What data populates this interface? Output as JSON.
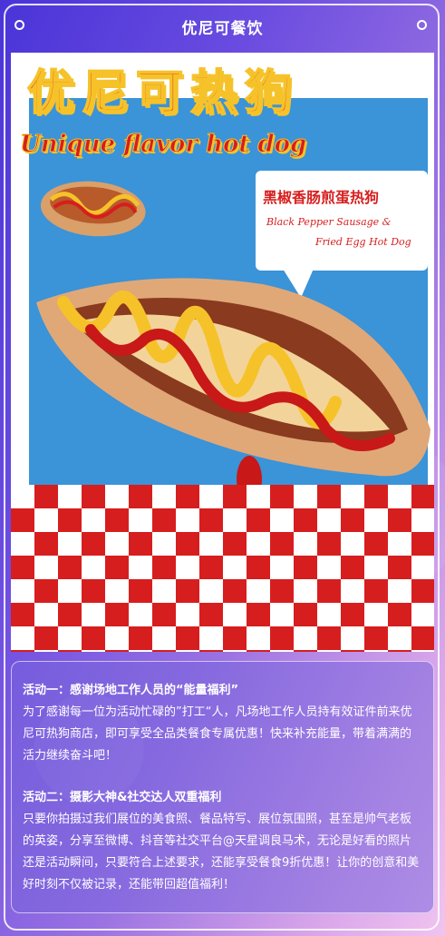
{
  "header": {
    "title": "优尼可餐饮"
  },
  "poster": {
    "title_cn": "优尼可热狗",
    "title_en": "Unique flavor hot dog",
    "bubble_cn": "黑椒香肠煎蛋热狗",
    "bubble_en_line1": "Black Pepper Sausage &",
    "bubble_en_line2": "Fried Egg Hot Dog"
  },
  "info": {
    "activity1_title": "活动一：感谢场地工作人员的“能量福利”",
    "activity1_body": "为了感谢每一位为活动忙碌的”打工“人，凡场地工作人员持有效证件前来优尼可热狗商店，即可享受全品类餐食专属优惠！快来补充能量，带着满满的活力继续奋斗吧！",
    "activity2_title": "活动二：摄影大神&社交达人双重福利",
    "activity2_body": "只要你拍摄过我们展位的美食照、餐品特写、展位氛围照，甚至是帅气老板的英姿，分享至微博、抖音等社交平台@天星调良马术，无论是好看的照片还是活动瞬间，只要符合上述要求，还能享受餐食9折优惠！让你的创意和美好时刻不仅被记录，还能带回超值福利！"
  },
  "colors": {
    "accent_red": "#d71e1e",
    "accent_yellow": "#f6c22a",
    "poster_blue": "#3b93d8"
  }
}
